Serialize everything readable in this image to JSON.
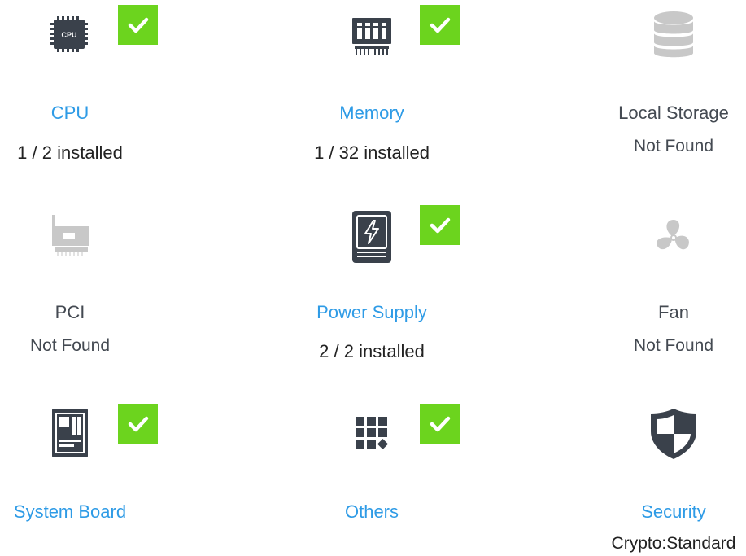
{
  "colors": {
    "link": "#2e9be6",
    "icon_active": "#3a414b",
    "icon_inactive": "#c8c8c8",
    "check_bg": "#6cd41e",
    "text": "#222222",
    "muted": "#444a52"
  },
  "tiles": [
    {
      "key": "cpu",
      "title": "CPU",
      "status": "1 / 2 installed",
      "icon": "cpu-icon",
      "icon_text": "CPU",
      "installed": true
    },
    {
      "key": "memory",
      "title": "Memory",
      "status": "1 / 32 installed",
      "icon": "memory-icon",
      "installed": true
    },
    {
      "key": "local_storage",
      "title": "Local Storage",
      "status": "Not Found",
      "icon": "database-icon",
      "installed": false
    },
    {
      "key": "pci",
      "title": "PCI",
      "status": "Not Found",
      "icon": "pci-card-icon",
      "installed": false
    },
    {
      "key": "power_supply",
      "title": "Power Supply",
      "status": "2 / 2 installed",
      "icon": "power-supply-icon",
      "installed": true
    },
    {
      "key": "fan",
      "title": "Fan",
      "status": "Not Found",
      "icon": "fan-icon",
      "installed": false
    },
    {
      "key": "system_board",
      "title": "System Board",
      "status": "",
      "icon": "system-board-icon",
      "installed": true
    },
    {
      "key": "others",
      "title": "Others",
      "status": "",
      "icon": "grid-icon",
      "installed": true
    },
    {
      "key": "security",
      "title": "Security",
      "status": "Crypto:Standard",
      "icon": "shield-icon",
      "installed": null
    }
  ]
}
